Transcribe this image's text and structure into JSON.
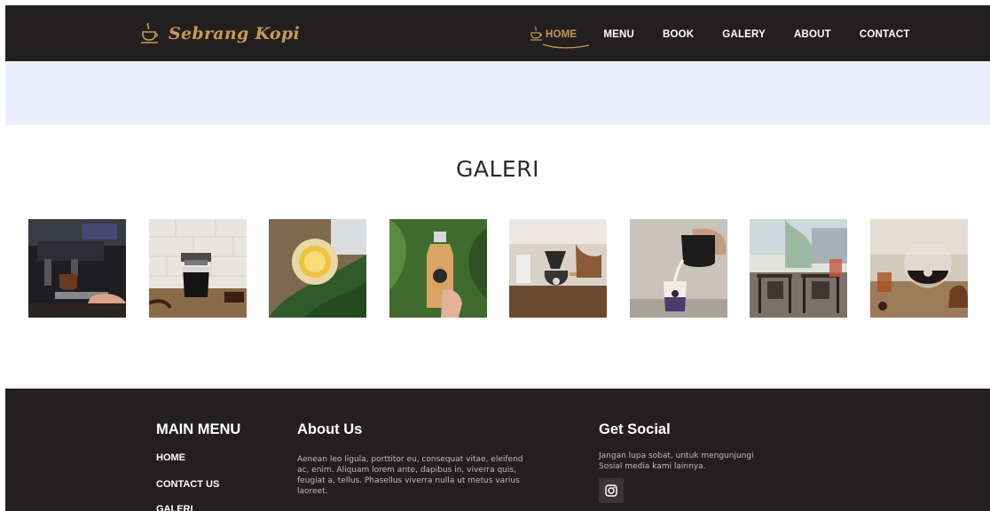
{
  "brand": {
    "name": "Sebrang Kopi"
  },
  "nav": {
    "items": [
      {
        "label": "HOME",
        "active": true
      },
      {
        "label": "MENU"
      },
      {
        "label": "BOOK"
      },
      {
        "label": "GALERY"
      },
      {
        "label": "ABOUT"
      },
      {
        "label": "CONTACT"
      }
    ]
  },
  "gallery": {
    "title": "GALERI",
    "images": [
      "espresso-machine-photo",
      "drip-coffee-cup-photo",
      "iced-lemon-drink-photo",
      "bottled-coffee-photo",
      "pour-over-set-photo",
      "milk-pour-glass-photo",
      "cafe-interior-photo",
      "coffee-server-photo"
    ]
  },
  "footer": {
    "main_menu": {
      "heading": "MAIN MENU",
      "links": [
        "HOME",
        "CONTACT US",
        "GALERI"
      ]
    },
    "about": {
      "heading": "About Us",
      "lines": [
        "Aenean leo ligula, porttitor eu, consequat vitae, eleifend",
        "ac, enim. Aliquam lorem ante, dapibus in, viverra quis,",
        "feugiat a, tellus. Phasellus viverra nulla ut metus varius",
        "laoreet."
      ]
    },
    "social": {
      "heading": "Get Social",
      "lines": [
        "Jangan lupa sobat, untuk mengunjungi",
        "Sosial media kami lainnya."
      ],
      "icon": "instagram-icon"
    }
  },
  "colors": {
    "nav_bg": "#231f20",
    "accent": "#c79a57",
    "hero_bg": "#eceefc",
    "footer_bg": "#231f20"
  }
}
